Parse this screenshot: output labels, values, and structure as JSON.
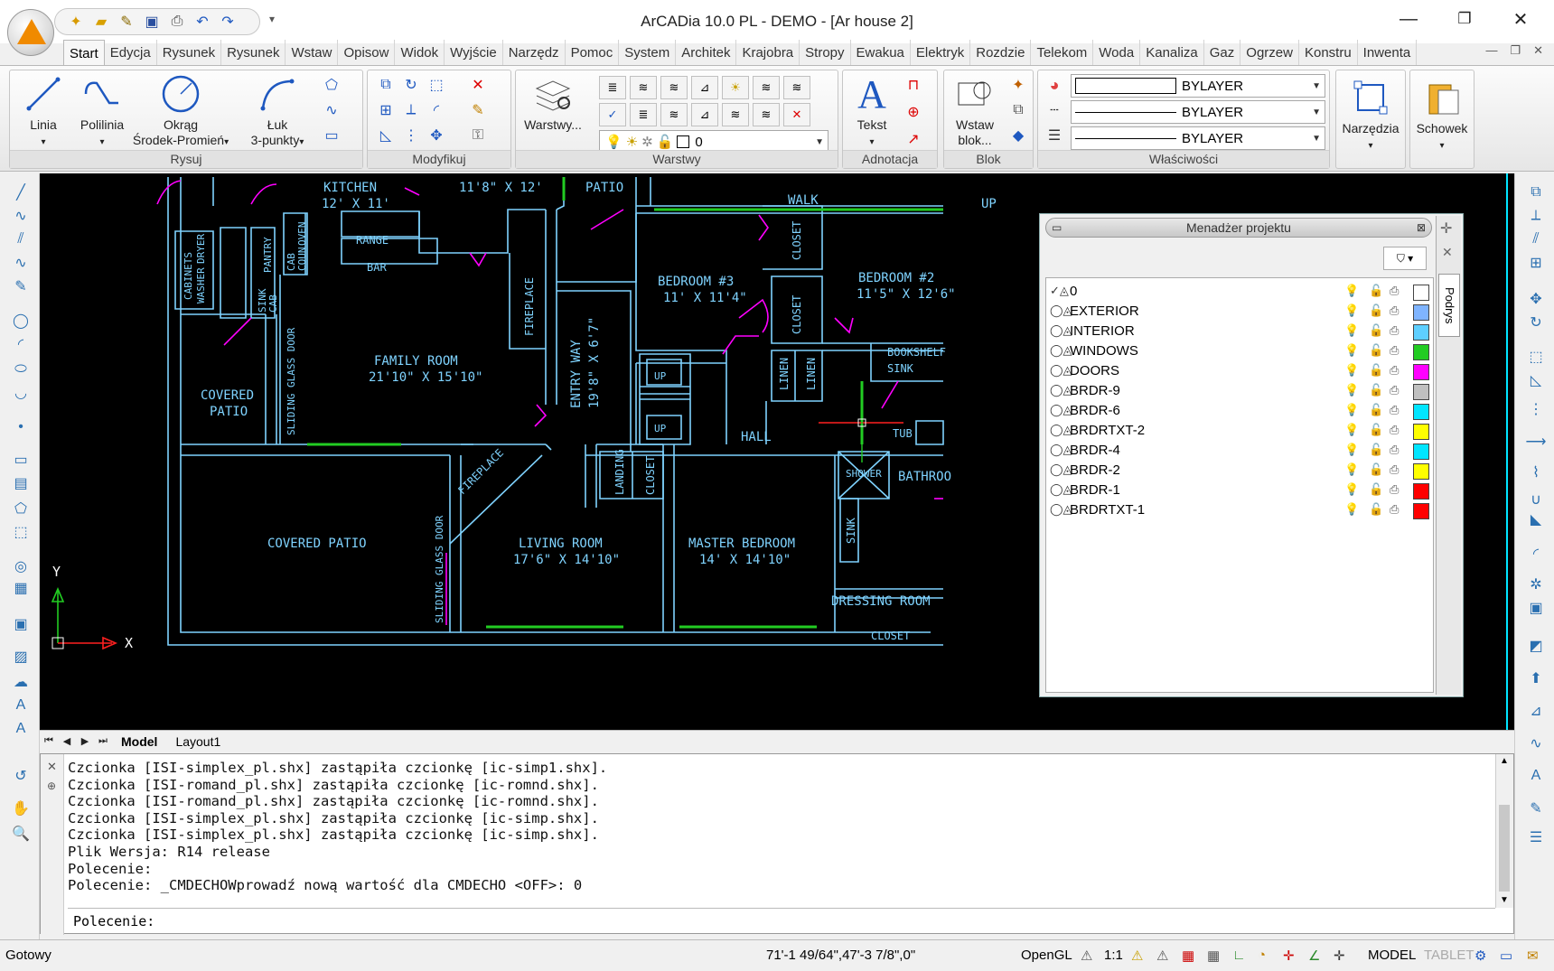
{
  "window": {
    "title": "ArCADia 10.0 PL - DEMO  - [Ar house 2]",
    "minimize": "—",
    "restore": "❐",
    "close": "✕"
  },
  "quick_access": [
    "new-icon",
    "open-icon",
    "draw-icon",
    "save-icon",
    "print-icon",
    "undo-icon",
    "redo-icon"
  ],
  "ribbon_tabs": [
    "Start",
    "Edycja",
    "Rysunek",
    "Rysunek",
    "Wstaw",
    "Opisow",
    "Widok",
    "Wyjście",
    "Narzędz",
    "Pomoc",
    "System",
    "Architek",
    "Krajobra",
    "Stropy",
    "Ewakua",
    "Elektryk",
    "Rozdzie",
    "Telekom",
    "Woda",
    "Kanaliza",
    "Gaz",
    "Ogrzew",
    "Konstru",
    "Inwenta"
  ],
  "ribbon": {
    "rysuj": {
      "title": "Rysuj",
      "linia": "Linia",
      "polilinia": "Polilinia",
      "okrag_1": "Okrąg",
      "okrag_2": "Środek-Promień",
      "luk_1": "Łuk",
      "luk_2": "3-punkty"
    },
    "modyfikuj": {
      "title": "Modyfikuj"
    },
    "warstwy": {
      "title": "Warstwy",
      "button": "Warstwy...",
      "current_layer": "0"
    },
    "adnotacja": {
      "title": "Adnotacja",
      "tekst": "Tekst"
    },
    "blok": {
      "title": "Blok",
      "wstaw_1": "Wstaw",
      "wstaw_2": "blok..."
    },
    "wlasciwosci": {
      "title": "Właściwości",
      "color": "BYLAYER",
      "linetype": "BYLAYER",
      "lineweight": "BYLAYER"
    },
    "narzedzia": "Narzędzia",
    "schowek": "Schowek"
  },
  "drawing": {
    "labels": {
      "kitchen": "KITCHEN",
      "kitchen_size": "12' X 11'",
      "dim_top": "11'8\" X 12'",
      "patio": "PATIO",
      "walk": "WALK",
      "up": "UP",
      "range": "RANGE",
      "bar": "BAR",
      "bedroom3": "BEDROOM #3",
      "bedroom3_size": "11' X 11'4\"",
      "bedroom2": "BEDROOM #2",
      "bedroom2_size": "11'5\" X 12'6\"",
      "closet": "CLOSET",
      "family_room": "FAMILY ROOM",
      "family_room_size": "21'10\" X 15'10\"",
      "covered_patio": "COVERED",
      "covered_patio_2": "PATIO",
      "covered_patio_big": "COVERED PATIO",
      "fireplace": "FIREPLACE",
      "entry_way": "ENTRY WAY",
      "entry_way_size": "19'8\" X 6'7\"",
      "hall": "HALL",
      "tub": "TUB",
      "bookshelf": "BOOKSHELF",
      "sink": "SINK",
      "linen": "LINEN",
      "landing": "LANDING",
      "shower": "SHOWER",
      "bathroom": "BATHROO",
      "living_room": "LIVING ROOM",
      "living_room_size": "17'6\" X 14'10\"",
      "master_bedroom": "MASTER BEDROOM",
      "master_bedroom_size": "14' X 14'10\"",
      "dressing_room": "DRESSING ROOM",
      "sliding_door": "SLIDING GLASS DOOR",
      "cabinets": "CABINETS",
      "washer": "WASHER",
      "dryer": "DRYER",
      "pantry": "PANTRY",
      "sink_cab": "SINK",
      "cab": "CAB",
      "oven": "OVEN",
      "cab_coun": "CAB",
      "coun": "COUN",
      "axis_x": "X",
      "axis_y": "Y"
    }
  },
  "model_tabs": {
    "model": "Model",
    "layout1": "Layout1"
  },
  "project_manager": {
    "title": "Menadżer projektu",
    "side_tab": "Podrys",
    "layers": [
      {
        "name": "0",
        "color": "#ffffff"
      },
      {
        "name": "EXTERIOR",
        "color": "#7fb4ff"
      },
      {
        "name": "INTERIOR",
        "color": "#5ecfff"
      },
      {
        "name": "WINDOWS",
        "color": "#22cc22"
      },
      {
        "name": "DOORS",
        "color": "#ff00ff"
      },
      {
        "name": "BRDR-9",
        "color": "#c0c0c0"
      },
      {
        "name": "BRDR-6",
        "color": "#00e5ff"
      },
      {
        "name": "BRDRTXT-2",
        "color": "#ffff00"
      },
      {
        "name": "BRDR-4",
        "color": "#00e5ff"
      },
      {
        "name": "BRDR-2",
        "color": "#ffff00"
      },
      {
        "name": "BRDR-1",
        "color": "#ff0000"
      },
      {
        "name": "BRDRTXT-1",
        "color": "#ff0000"
      }
    ]
  },
  "command": {
    "lines": [
      "Czcionka [ISI-simplex_pl.shx] zastąpiła czcionkę [ic-simp1.shx].",
      "Czcionka [ISI-romand_pl.shx] zastąpiła czcionkę [ic-romnd.shx].",
      "Czcionka [ISI-romand_pl.shx] zastąpiła czcionkę [ic-romnd.shx].",
      "Czcionka [ISI-simplex_pl.shx] zastąpiła czcionkę [ic-simp.shx].",
      "Czcionka [ISI-simplex_pl.shx] zastąpiła czcionkę [ic-simp.shx].",
      "Plik Wersja: R14 release",
      "Polecenie:",
      "Polecenie: _CMDECHOWprowadź nową wartość dla CMDECHO <OFF>: 0"
    ],
    "prompt": "Polecenie:"
  },
  "status": {
    "state": "Gotowy",
    "coords": "71'-1 49/64\",47'-3 7/8\",0\"",
    "renderer": "OpenGL",
    "scale": "1:1",
    "model": "MODEL",
    "tablet": "TABLET"
  }
}
